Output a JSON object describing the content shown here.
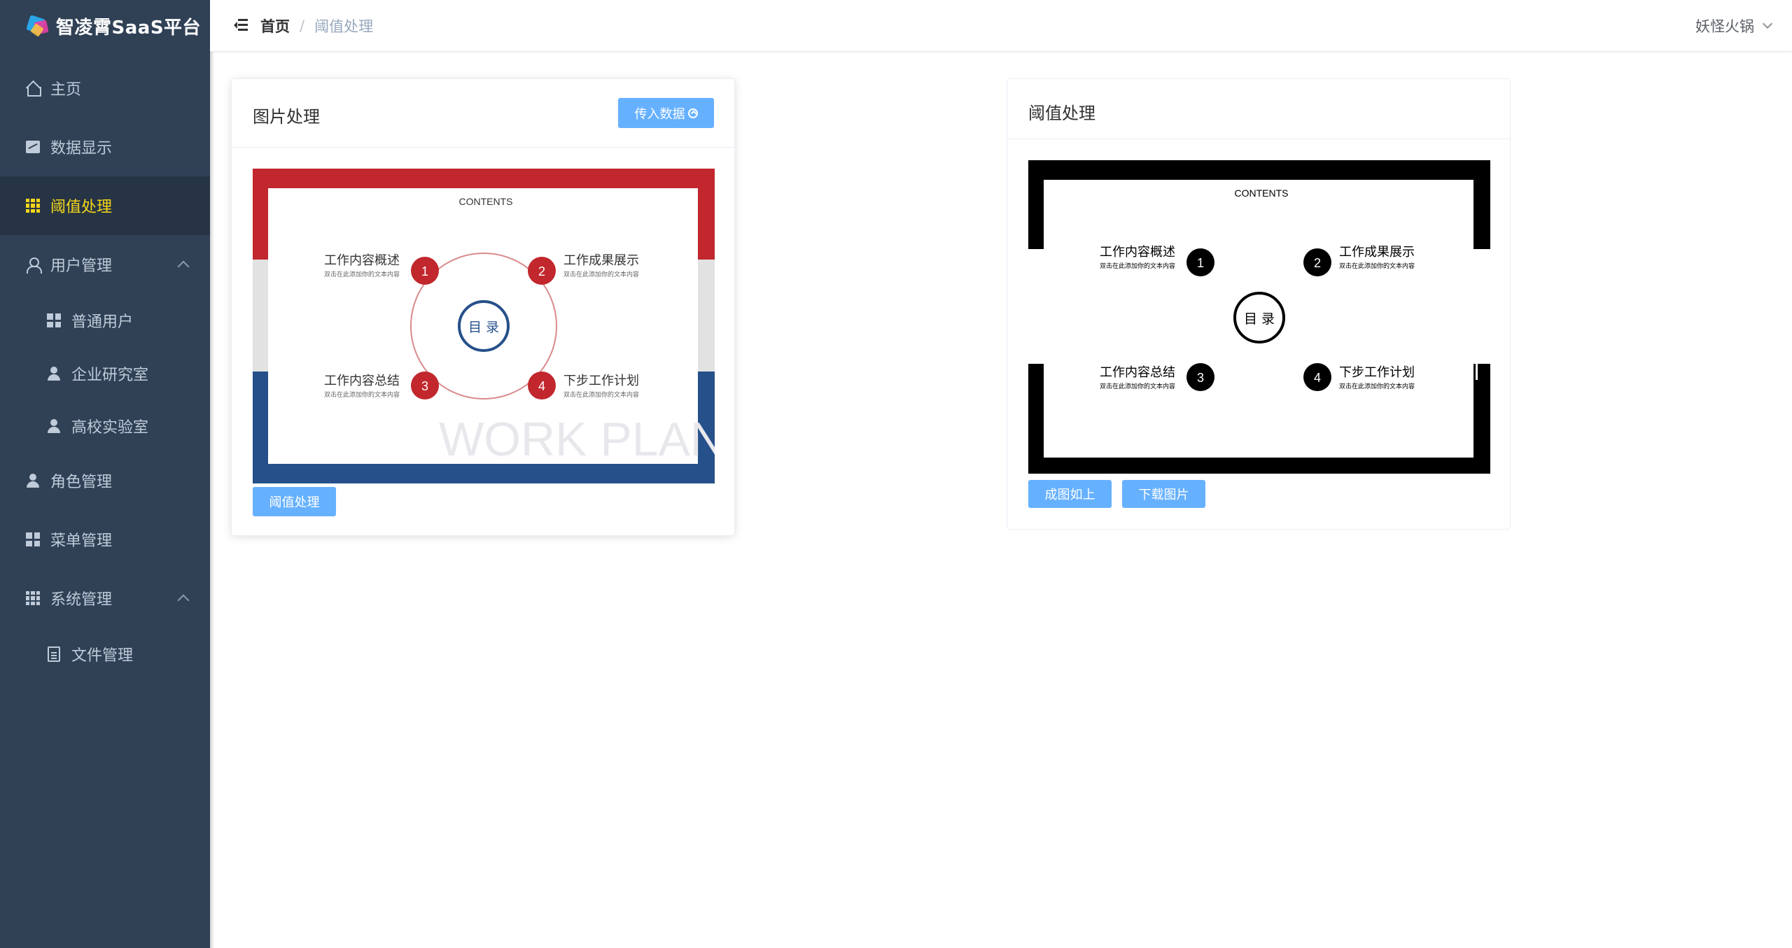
{
  "app": {
    "logo_text": "智凌霄SaaS平台"
  },
  "sidebar": {
    "items": [
      {
        "label": "主页",
        "icon": "home-icon"
      },
      {
        "label": "数据显示",
        "icon": "chart-icon"
      },
      {
        "label": "阈值处理",
        "icon": "grid-icon",
        "active": true
      },
      {
        "label": "用户管理",
        "icon": "user-icon",
        "expanded": true
      },
      {
        "label": "普通用户",
        "icon": "grid-icon"
      },
      {
        "label": "企业研究室",
        "icon": "user-icon"
      },
      {
        "label": "高校实验室",
        "icon": "user-icon"
      },
      {
        "label": "角色管理",
        "icon": "user-icon"
      },
      {
        "label": "菜单管理",
        "icon": "grid-icon"
      },
      {
        "label": "系统管理",
        "icon": "grid-icon",
        "expanded": true
      },
      {
        "label": "文件管理",
        "icon": "document-icon"
      }
    ]
  },
  "navbar": {
    "breadcrumb_home": "首页",
    "breadcrumb_separator": "/",
    "breadcrumb_current": "阈值处理",
    "user_name": "妖怪火锅"
  },
  "left_card": {
    "title": "图片处理",
    "upload_button": "传入数据",
    "process_button": "阈值处理"
  },
  "right_card": {
    "title": "阈值处理",
    "result_button": "成图如上",
    "download_button": "下载图片"
  },
  "slide": {
    "heading": "CONTENTS",
    "center": "目 录",
    "watermark": "WORK PLAN",
    "subtitle": "双击在此添加你的文本内容",
    "items": [
      {
        "number": "1",
        "title": "工作内容概述"
      },
      {
        "number": "2",
        "title": "工作成果展示"
      },
      {
        "number": "3",
        "title": "工作内容总结"
      },
      {
        "number": "4",
        "title": "下步工作计划"
      }
    ]
  },
  "colors": {
    "sidebar_bg": "#304156",
    "sidebar_active": "#f4d51a",
    "button": "#66b1ff",
    "slide_red": "#c1272d",
    "slide_blue": "#26508a",
    "slide_grey": "#e2e2e2"
  }
}
